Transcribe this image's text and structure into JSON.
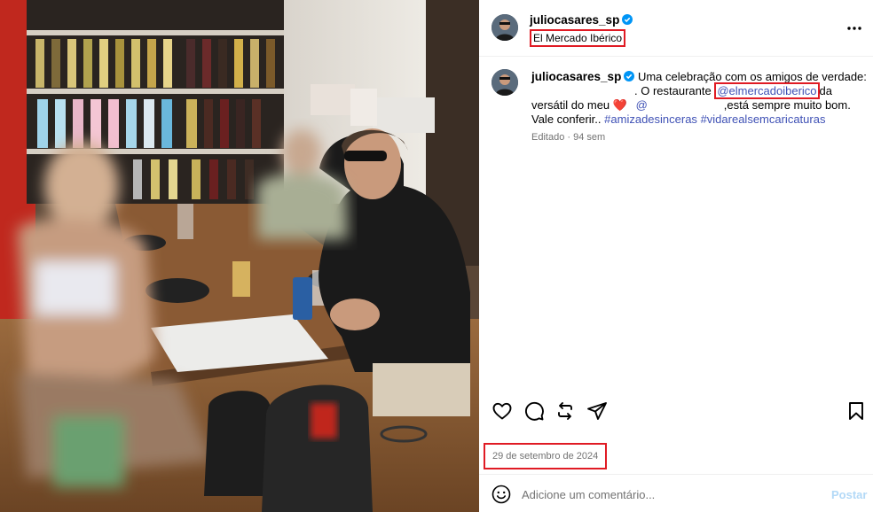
{
  "header": {
    "username": "juliocasares_sp",
    "location": "El Mercado Ibérico",
    "more_icon": "more-horizontal-icon"
  },
  "caption": {
    "username": "juliocasares_sp",
    "text_1": "Uma celebração com os amigos de verdade:",
    "text_2": ". O restaurante",
    "mention_restaurant": "@elmercadoiberico",
    "text_3": "da",
    "text_4": "versátil do meu",
    "heart": "❤️",
    "mention_friend": "@",
    "text_5": ",está sempre muito bom.",
    "text_6": "Vale conferir..",
    "hashtag_1": "#amizadesinceras",
    "hashtag_2": "#vidarealsemcaricaturas",
    "edited": "Editado",
    "time_ago": "94 sem"
  },
  "actions": {
    "like_icon": "heart-icon",
    "comment_icon": "comment-icon",
    "share_icon": "repost-icon",
    "send_icon": "send-icon",
    "save_icon": "bookmark-icon"
  },
  "date": "29 de setembro de 2024",
  "comment": {
    "emoji_icon": "emoji-icon",
    "placeholder": "Adicione um comentário...",
    "post_label": "Postar"
  },
  "colors": {
    "link": "#3f51b5",
    "highlight_box": "#e01b24",
    "verified": "#0095f6",
    "post_disabled": "#b3d9f7"
  }
}
